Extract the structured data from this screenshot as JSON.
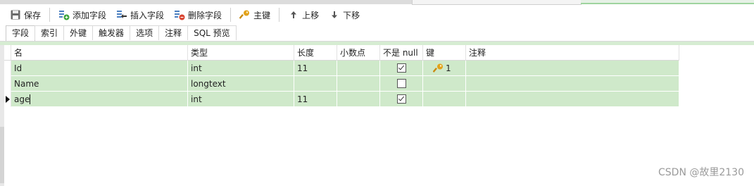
{
  "toolbar": {
    "save": "保存",
    "add_field": "添加字段",
    "insert_field": "插入字段",
    "delete_field": "删除字段",
    "primary_key": "主键",
    "move_up": "上移",
    "move_down": "下移"
  },
  "tabs": [
    "字段",
    "索引",
    "外键",
    "触发器",
    "选项",
    "注释",
    "SQL 预览"
  ],
  "columns": [
    "名",
    "类型",
    "长度",
    "小数点",
    "不是 null",
    "键",
    "注释"
  ],
  "rows": [
    {
      "name": "Id",
      "type": "int",
      "length": "11",
      "decimals": "",
      "not_null": true,
      "key": "1",
      "comment": ""
    },
    {
      "name": "Name",
      "type": "longtext",
      "length": "",
      "decimals": "",
      "not_null": false,
      "key": "",
      "comment": ""
    },
    {
      "name": "age",
      "type": "int",
      "length": "11",
      "decimals": "",
      "not_null": true,
      "key": "",
      "comment": ""
    }
  ],
  "watermark": "CSDN @故里2130"
}
